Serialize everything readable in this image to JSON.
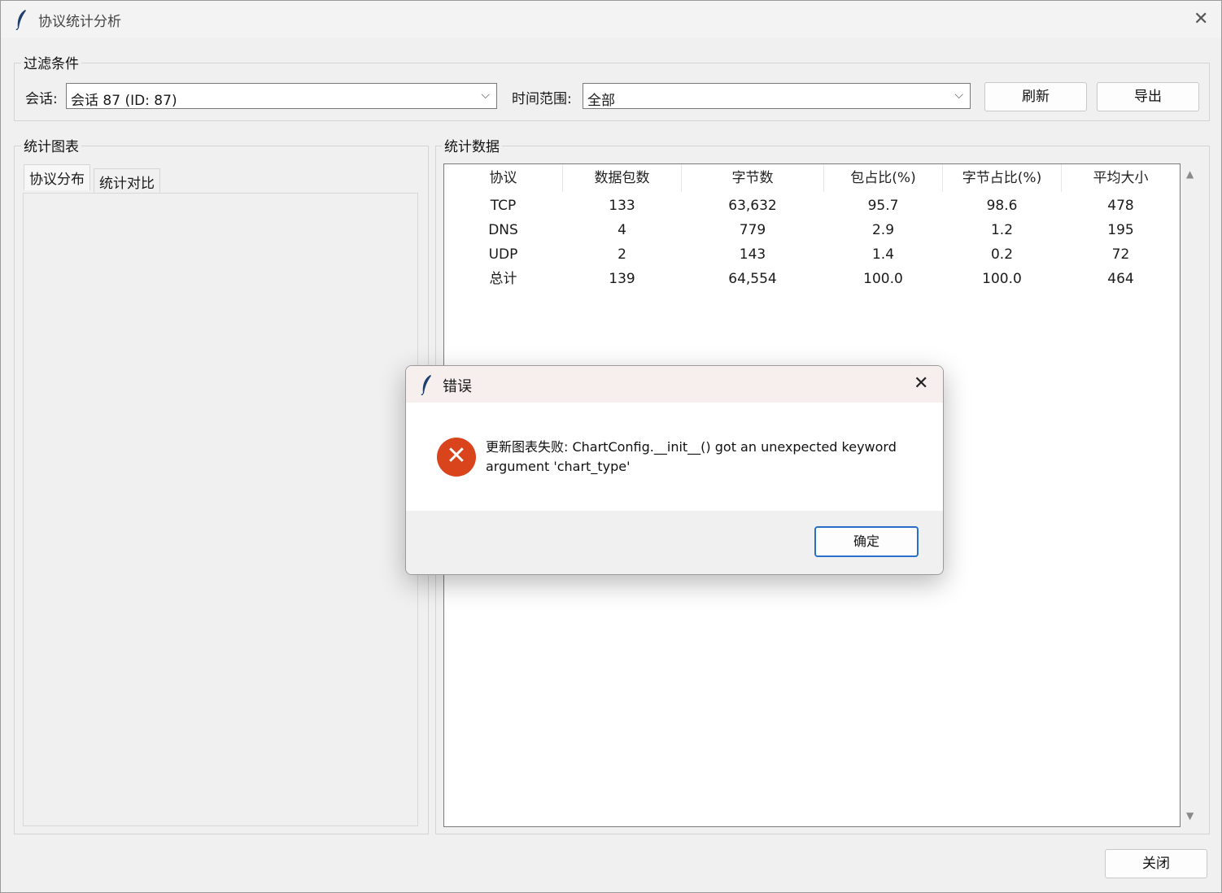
{
  "window": {
    "title": "协议统计分析"
  },
  "filter": {
    "group_label": "过滤条件",
    "session_label": "会话:",
    "session_value": "会话 87 (ID: 87)",
    "time_label": "时间范围:",
    "time_value": "全部",
    "refresh_label": "刷新",
    "export_label": "导出"
  },
  "chart_panel": {
    "group_label": "统计图表",
    "tabs": [
      "协议分布",
      "统计对比"
    ]
  },
  "stats_panel": {
    "group_label": "统计数据",
    "columns": [
      "协议",
      "数据包数",
      "字节数",
      "包占比(%)",
      "字节占比(%)",
      "平均大小"
    ],
    "rows": [
      [
        "TCP",
        "133",
        "63,632",
        "95.7",
        "98.6",
        "478"
      ],
      [
        "DNS",
        "4",
        "779",
        "2.9",
        "1.2",
        "195"
      ],
      [
        "UDP",
        "2",
        "143",
        "1.4",
        "0.2",
        "72"
      ],
      [
        "总计",
        "139",
        "64,554",
        "100.0",
        "100.0",
        "464"
      ]
    ]
  },
  "close_label": "关闭",
  "dialog": {
    "title": "错误",
    "message": "更新图表失败: ChartConfig.__init__() got an unexpected keyword argument 'chart_type'",
    "ok_label": "确定",
    "icon": "error-icon",
    "icon_color": "#d9441c"
  }
}
